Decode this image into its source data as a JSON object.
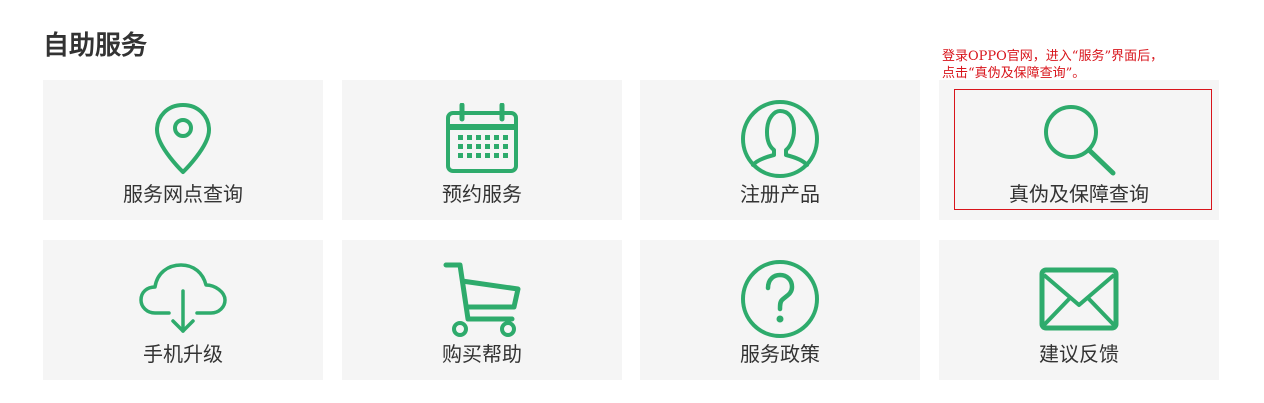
{
  "section": {
    "title": "自助服务"
  },
  "tiles": [
    {
      "label": "服务网点查询",
      "icon": "location-pin-icon"
    },
    {
      "label": "预约服务",
      "icon": "calendar-icon"
    },
    {
      "label": "注册产品",
      "icon": "user-profile-icon"
    },
    {
      "label": "真伪及保障查询",
      "icon": "search-icon"
    },
    {
      "label": "手机升级",
      "icon": "cloud-download-icon"
    },
    {
      "label": "购买帮助",
      "icon": "shopping-cart-icon"
    },
    {
      "label": "服务政策",
      "icon": "question-mark-icon"
    },
    {
      "label": "建议反馈",
      "icon": "envelope-icon"
    }
  ],
  "annotation": {
    "text": "登录OPPO官网，进入“服务”界面后，\n点击“真伪及保障查询”。"
  },
  "colors": {
    "accent": "#2eab6c",
    "tile_background": "#f5f5f5",
    "annotation": "#d8141b",
    "text": "#333333"
  }
}
